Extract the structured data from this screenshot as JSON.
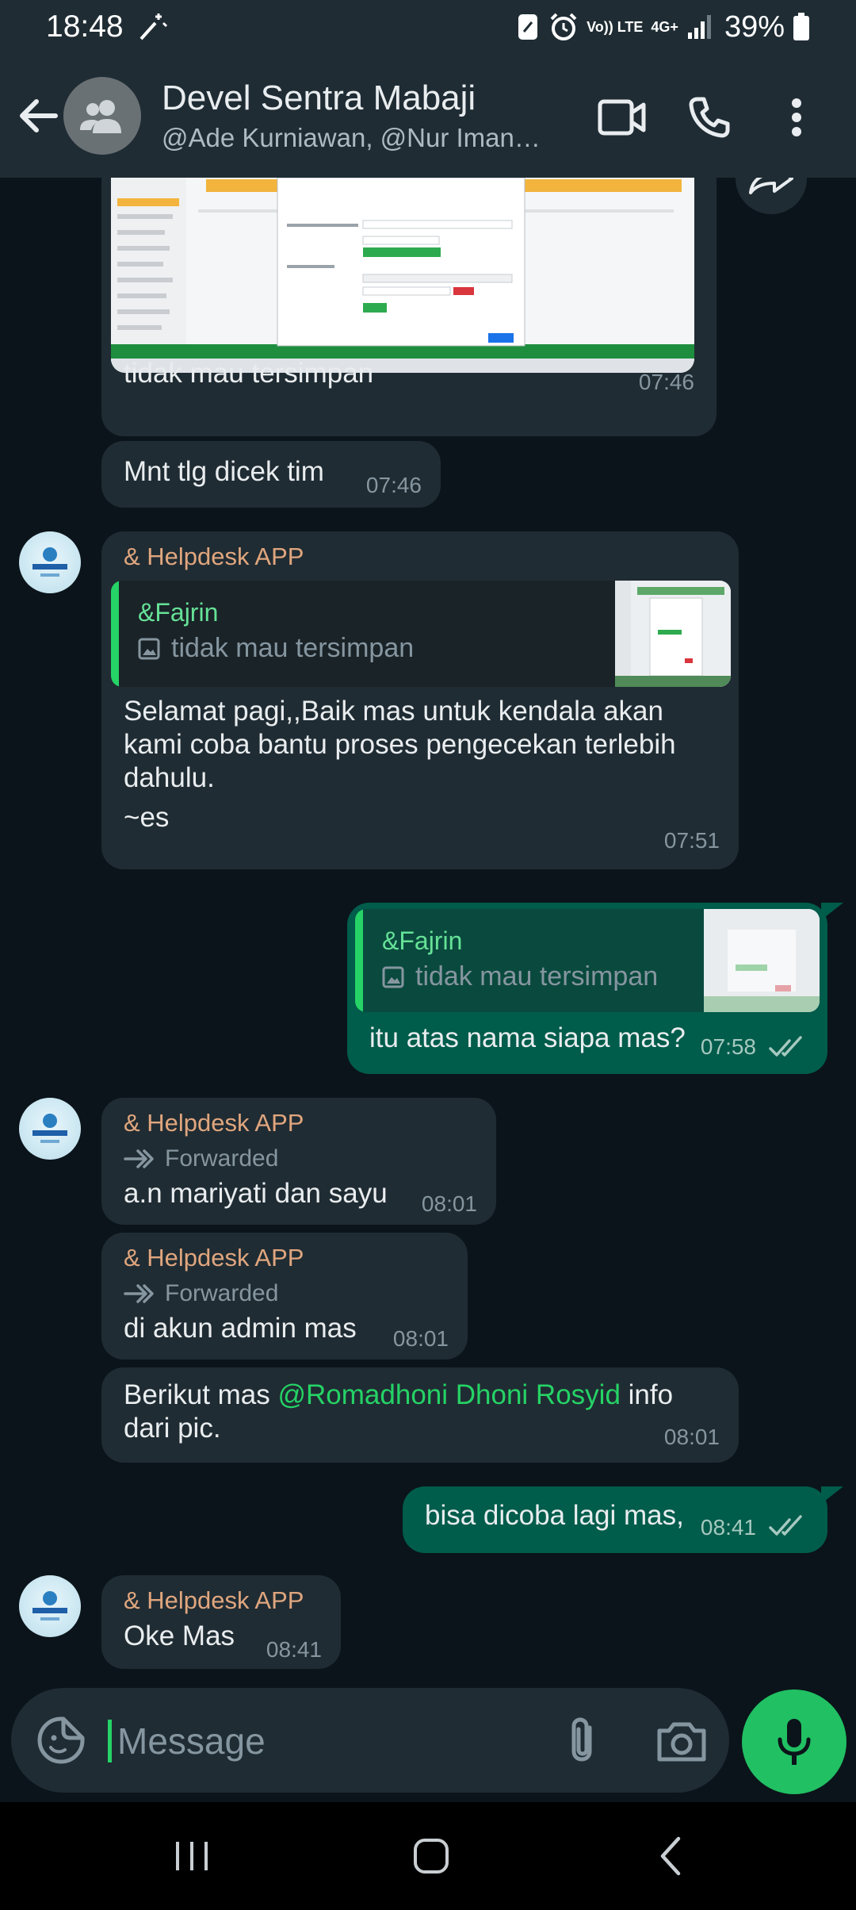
{
  "status_bar": {
    "time": "18:48",
    "volte": "Vo)) LTE",
    "network": "4G+",
    "battery": "39%"
  },
  "header": {
    "title": "Devel Sentra Mabaji",
    "subtitle": "@Ade Kurniawan, @Nur Iman…"
  },
  "messages": [
    {
      "caption": "tidak mau tersimpan",
      "time": "07:46"
    },
    {
      "text": "Mnt tlg dicek tim",
      "time": "07:46"
    },
    {
      "sender": "& Helpdesk APP",
      "quote_name": "&Fajrin",
      "quote_text": "tidak mau tersimpan",
      "text": "Selamat pagi,,Baik mas untuk kendala akan kami coba bantu proses pengecekan terlebih dahulu.",
      "signature": "~es",
      "time": "07:51"
    },
    {
      "quote_name": "&Fajrin",
      "quote_text": "tidak mau tersimpan",
      "text": "itu atas nama siapa mas?",
      "time": "07:58"
    },
    {
      "sender": "& Helpdesk APP",
      "forwarded": "Forwarded",
      "text": "a.n mariyati dan sayu",
      "time": "08:01"
    },
    {
      "sender": "& Helpdesk APP",
      "forwarded": "Forwarded",
      "text": "di akun admin mas",
      "time": "08:01"
    },
    {
      "text_before": "Berikut mas ",
      "mention": "@Romadhoni Dhoni Rosyid",
      "text_after": " info dari pic.",
      "time": "08:01"
    },
    {
      "text": "bisa dicoba lagi mas,",
      "time": "08:41"
    },
    {
      "sender": "& Helpdesk APP",
      "text": "Oke Mas",
      "time": "08:41"
    }
  ],
  "input": {
    "placeholder": "Message"
  },
  "colors": {
    "accent": "#25d366",
    "outgoing": "#005c4b",
    "incoming": "#202c33",
    "sender": "#e0a67e"
  }
}
